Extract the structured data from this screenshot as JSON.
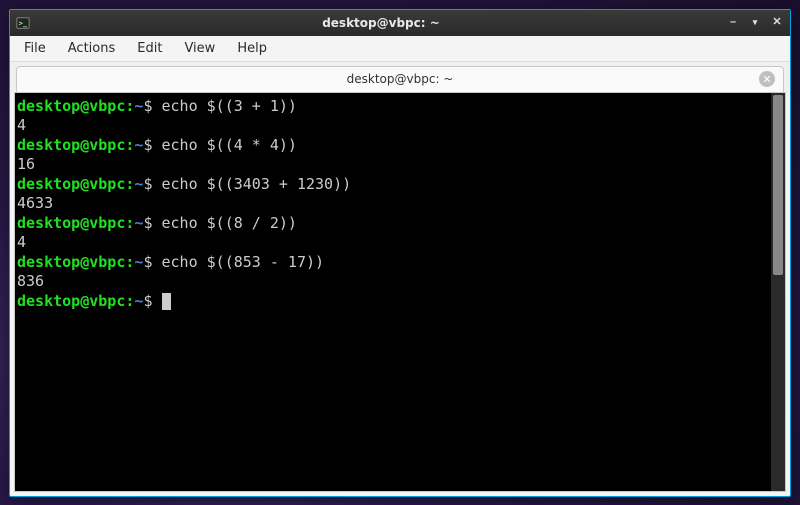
{
  "window": {
    "title": "desktop@vbpc: ~"
  },
  "menubar": {
    "file": "File",
    "actions": "Actions",
    "edit": "Edit",
    "view": "View",
    "help": "Help"
  },
  "tab": {
    "title": "desktop@vbpc: ~"
  },
  "prompt": {
    "user_host": "desktop@vbpc",
    "path": "~",
    "symbol": "$"
  },
  "session": [
    {
      "cmd": "echo $((3 + 1))",
      "out": "4"
    },
    {
      "cmd": "echo $((4 * 4))",
      "out": "16"
    },
    {
      "cmd": "echo $((3403 + 1230))",
      "out": "4633"
    },
    {
      "cmd": "echo $((8 / 2))",
      "out": "4"
    },
    {
      "cmd": "echo $((853 - 17))",
      "out": "836"
    }
  ]
}
